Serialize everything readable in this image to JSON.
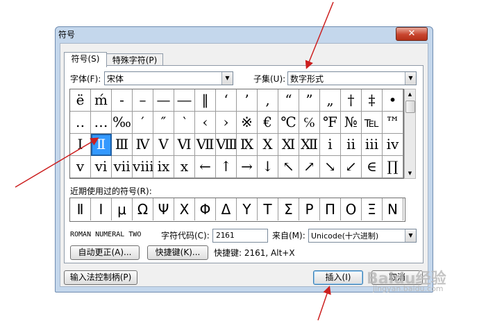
{
  "dialog": {
    "title": "符号",
    "close_label": "✕",
    "tabs": [
      {
        "label": "符号(S)"
      },
      {
        "label": "特殊字符(P)"
      }
    ]
  },
  "font": {
    "label": "字体(F):",
    "value": "宋体"
  },
  "subset": {
    "label": "子集(U):",
    "value": "数字形式"
  },
  "symbol_grid": {
    "rows": [
      [
        "ë",
        "ḿ",
        "-",
        "–",
        "—",
        "―",
        "‖",
        "‘",
        "’",
        ",",
        "“",
        "”",
        "„",
        "†",
        "‡",
        "•"
      ],
      [
        "‥",
        "…",
        "‰",
        "′",
        "″",
        "‵",
        "‹",
        "›",
        "※",
        "€",
        "℃",
        "℅",
        "℉",
        "№",
        "℡",
        "™"
      ],
      [
        "Ⅰ",
        "Ⅱ",
        "Ⅲ",
        "Ⅳ",
        "Ⅴ",
        "Ⅵ",
        "Ⅶ",
        "Ⅷ",
        "Ⅸ",
        "Ⅹ",
        "Ⅺ",
        "Ⅻ",
        "ⅰ",
        "ⅱ",
        "ⅲ",
        "ⅳ"
      ],
      [
        "ⅴ",
        "ⅵ",
        "ⅶ",
        "ⅷ",
        "ⅸ",
        "ⅹ",
        "←",
        "↑",
        "→",
        "↓",
        "↖",
        "↗",
        "↘",
        "↙",
        "∈",
        "∏"
      ]
    ]
  },
  "recent": {
    "label": "近期使用过的符号(R):",
    "symbols": [
      "Ⅱ",
      "Ⅰ",
      "μ",
      "Ω",
      "Ψ",
      "Χ",
      "Φ",
      "Δ",
      "Υ",
      "Τ",
      "Σ",
      "Ρ",
      "Π",
      "Ο",
      "Ξ",
      "Ν"
    ]
  },
  "char_name": "ROMAN NUMERAL TWO",
  "char_code": {
    "label": "字符代码(C):",
    "value": "2161"
  },
  "from": {
    "label": "来自(M):",
    "value": "Unicode(十六进制)"
  },
  "buttons": {
    "autocorrect": "自动更正(A)...",
    "shortcut_key": "快捷键(K)...",
    "shortcut_text": "快捷键: 2161, Alt+X",
    "ime_handle": "输入法控制柄(P)",
    "insert": "插入(I)",
    "cancel": "取消"
  },
  "watermark": {
    "logo": "Baidu经验",
    "url": "jingyan.baidu.com"
  },
  "colors": {
    "selection": "#3399ff",
    "annotation_arrow": "#cc1f1f"
  }
}
